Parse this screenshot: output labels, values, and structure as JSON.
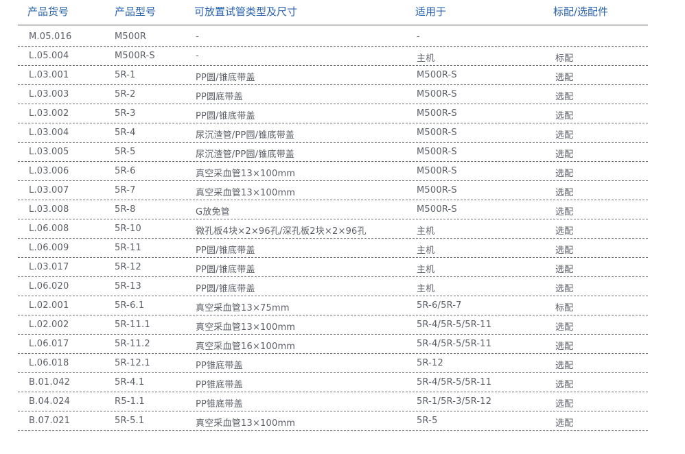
{
  "table": {
    "headers": [
      "产品货号",
      "产品型号",
      "可放置试管类型及尺寸",
      "适用于",
      "标配/选配件"
    ],
    "rows": [
      [
        "M.05.016",
        "M500R",
        "-",
        "-",
        ""
      ],
      [
        "L.05.004",
        "M500R-S",
        "-",
        "主机",
        "标配"
      ],
      [
        "L.03.001",
        "5R-1",
        "PP圆/锥底带盖",
        "M500R-S",
        "选配"
      ],
      [
        "L.03.003",
        "5R-2",
        "PP圆底带盖",
        "M500R-S",
        "选配"
      ],
      [
        "L.03.002",
        "5R-3",
        "PP圆/锥底带盖",
        "M500R-S",
        "选配"
      ],
      [
        "L.03.004",
        "5R-4",
        "尿沉渣管/PP圆/锥底带盖",
        "M500R-S",
        "选配"
      ],
      [
        "L.03.005",
        "5R-5",
        "尿沉渣管/PP圆/锥底带盖",
        "M500R-S",
        "选配"
      ],
      [
        "L.03.006",
        "5R-6",
        "真空采血管13×100mm",
        "M500R-S",
        "选配"
      ],
      [
        "L.03.007",
        "5R-7",
        "真空采血管13×100mm",
        "M500R-S",
        "选配"
      ],
      [
        "L.03.008",
        "5R-8",
        "G放免管",
        "M500R-S",
        "选配"
      ],
      [
        "L.06.008",
        "5R-10",
        "微孔板4块×2×96孔/深孔板2块×2×96孔",
        "主机",
        "选配"
      ],
      [
        "L.06.009",
        "5R-11",
        "PP圆/锥底带盖",
        "主机",
        "选配"
      ],
      [
        "L.03.017",
        "5R-12",
        "PP圆/锥底带盖",
        "主机",
        "选配"
      ],
      [
        "L.06.020",
        "5R-13",
        "PP圆/锥底带盖",
        "主机",
        "选配"
      ],
      [
        "L.02.001",
        "5R-6.1",
        "真空采血管13×75mm",
        "5R-6/5R-7",
        "标配"
      ],
      [
        "L.02.002",
        "5R-11.1",
        "真空采血管13×100mm",
        "5R-4/5R-5/5R-11",
        "选配"
      ],
      [
        "L.06.017",
        "5R-11.2",
        "真空采血管16×100mm",
        "5R-4/5R-5/5R-11",
        "选配"
      ],
      [
        "L.06.018",
        "5R-12.1",
        "PP锥底带盖",
        "5R-12",
        "选配"
      ],
      [
        "B.01.042",
        "5R-4.1",
        "PP锥底带盖",
        "5R-4/5R-5/5R-11",
        "选配"
      ],
      [
        "B.04.024",
        "R5-1.1",
        "PP锥底带盖",
        "5R-1/5R-3/5R-12",
        "选配"
      ],
      [
        "B.07.021",
        "5R-5.1",
        "真空采血管13×100mm",
        "5R-5",
        "选配"
      ]
    ]
  },
  "colors": {
    "header_text": "#2a64b0",
    "cell_text": "#5a5e66",
    "rule": "#6b6f76"
  }
}
